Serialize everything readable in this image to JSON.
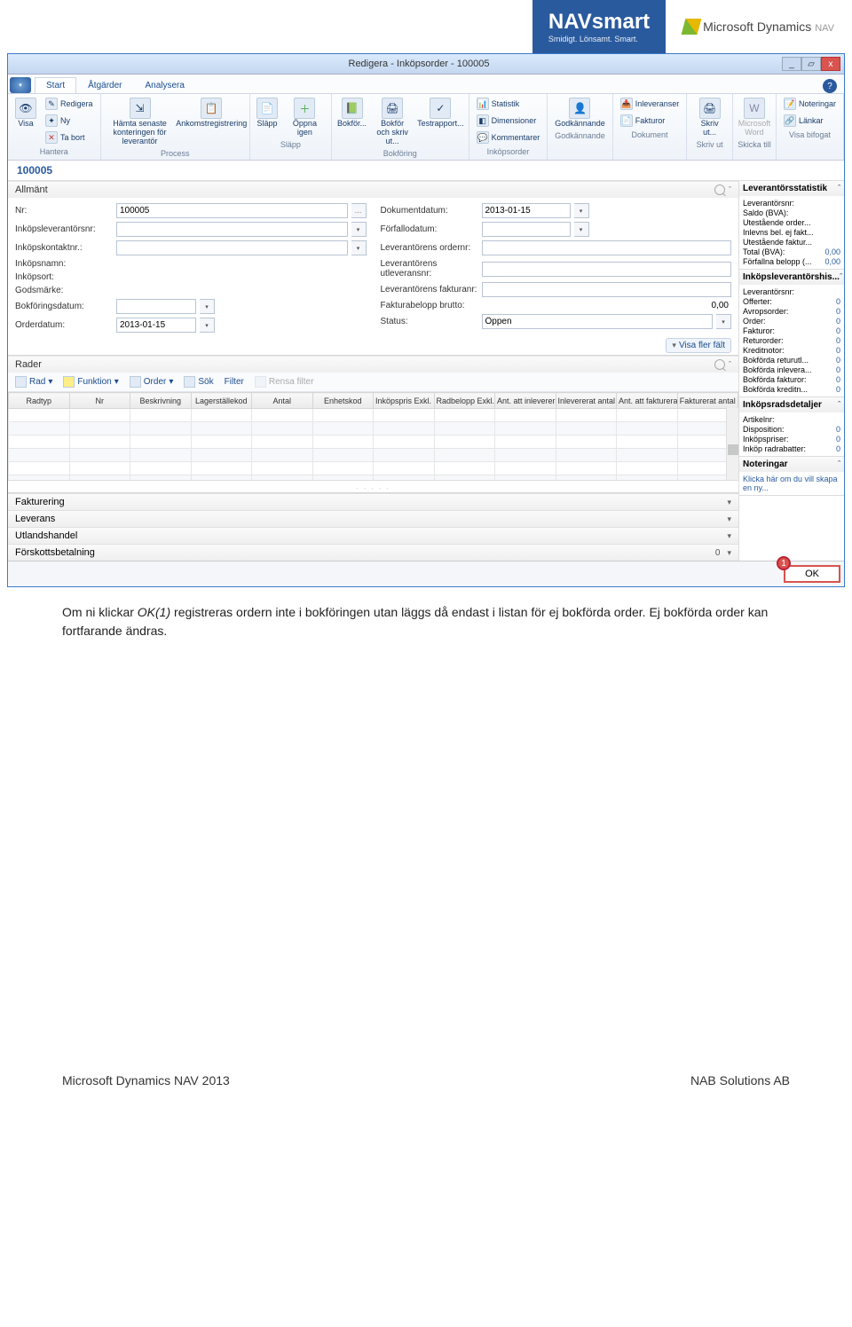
{
  "header": {
    "logo_name": "NAVsmart",
    "logo_tagline": "Smidigt. Lönsamt. Smart.",
    "msdyn": "Microsoft Dynamics",
    "msdyn_sub": "NAV"
  },
  "titlebar": {
    "title": "Redigera - Inköpsorder - 100005",
    "minimize": "_",
    "restore": "▱",
    "close": "x"
  },
  "tabs": {
    "start": "Start",
    "atgarder": "Åtgärder",
    "analysera": "Analysera"
  },
  "ribbon": {
    "hantera": {
      "label": "Hantera",
      "visa": "Visa",
      "redigera": "Redigera",
      "ny": "Ny",
      "tabort": "Ta bort"
    },
    "process": {
      "label": "Process",
      "hamta": "Hämta senaste konteringen för leverantör",
      "ankomst": "Ankomstregistrering"
    },
    "slapp": {
      "label": "Släpp",
      "slapp": "Släpp",
      "oppnaigen": "Öppna igen"
    },
    "bokforing": {
      "label": "Bokföring",
      "bokfor": "Bokför...",
      "bokforoch": "Bokför och skriv ut...",
      "testrapport": "Testrapport..."
    },
    "inkopsorder": {
      "label": "Inköpsorder",
      "statistik": "Statistik",
      "dimensioner": "Dimensioner",
      "kommentarer": "Kommentarer"
    },
    "godkannande": {
      "label": "Godkännande",
      "godkannande": "Godkännande"
    },
    "dokument": {
      "label": "Dokument",
      "inleveranser": "Inleveranser",
      "fakturor": "Fakturor"
    },
    "skrivut": {
      "label": "Skriv ut",
      "skrivut": "Skriv ut..."
    },
    "skickatill": {
      "label": "Skicka till",
      "word": "Microsoft Word"
    },
    "visabifogat": {
      "label": "Visa bifogat",
      "noteringar": "Noteringar",
      "lankar": "Länkar"
    }
  },
  "record_no": "100005",
  "allmant": {
    "title": "Allmänt",
    "left": {
      "nr": {
        "label": "Nr:",
        "value": "100005"
      },
      "inkopsleverantorsnr": {
        "label": "Inköpsleverantörsnr:",
        "value": ""
      },
      "inkopskontaktnr": {
        "label": "Inköpskontaktnr.:",
        "value": ""
      },
      "inkopsnamn": {
        "label": "Inköpsnamn:",
        "value": ""
      },
      "inkopsort": {
        "label": "Inköpsort:",
        "value": ""
      },
      "godsmarke": {
        "label": "Godsmärke:",
        "value": ""
      },
      "bokforingsdatum": {
        "label": "Bokföringsdatum:",
        "value": ""
      },
      "orderdatum": {
        "label": "Orderdatum:",
        "value": "2013-01-15"
      }
    },
    "right": {
      "dokumentdatum": {
        "label": "Dokumentdatum:",
        "value": "2013-01-15"
      },
      "forfallodatum": {
        "label": "Förfallodatum:",
        "value": ""
      },
      "leverantorensordernr": {
        "label": "Leverantörens ordernr:",
        "value": ""
      },
      "leverantorensutleveransnr": {
        "label": "Leverantörens utleveransnr:",
        "value": ""
      },
      "leverantorensfakturanr": {
        "label": "Leverantörens fakturanr:",
        "value": ""
      },
      "fakturabelopp": {
        "label": "Fakturabelopp brutto:",
        "value": "0,00"
      },
      "status": {
        "label": "Status:",
        "value": "Öppen"
      }
    },
    "show_more": "Visa fler fält"
  },
  "rader": {
    "title": "Rader",
    "toolbar": {
      "rad": "Rad",
      "funktion": "Funktion",
      "order": "Order",
      "sok": "Sök",
      "filter": "Filter",
      "rensa": "Rensa filter"
    },
    "columns": [
      "Radtyp",
      "Nr",
      "Beskrivning",
      "Lagerställekod",
      "Antal",
      "Enhetskod",
      "Inköpspris Exkl. moms",
      "Radbelopp Exkl. moms",
      "Ant. att inlevereras",
      "Inlevererat antal",
      "Ant. att fakturera",
      "Fakturerat antal"
    ]
  },
  "collapsed": {
    "fakturering": "Fakturering",
    "leverans": "Leverans",
    "utlandshandel": "Utlandshandel",
    "forskott": {
      "label": "Förskottsbetalning",
      "summary": "0"
    }
  },
  "factboxes": {
    "levstat": {
      "title": "Leverantörsstatistik",
      "rows": [
        {
          "l": "Leverantörsnr:",
          "v": ""
        },
        {
          "l": "Saldo (BVA):",
          "v": ""
        },
        {
          "l": "Utestående order...",
          "v": ""
        },
        {
          "l": "Inlevns bel. ej fakt...",
          "v": ""
        },
        {
          "l": "Utestående faktur...",
          "v": ""
        },
        {
          "l": "Total (BVA):",
          "v": "0,00"
        },
        {
          "l": "Förfallna belopp (...",
          "v": "0,00"
        }
      ]
    },
    "levhist": {
      "title": "Inköpsleverantörshis...",
      "rows": [
        {
          "l": "Leverantörsnr:",
          "v": ""
        },
        {
          "l": "Offerter:",
          "v": "0"
        },
        {
          "l": "Avropsorder:",
          "v": "0"
        },
        {
          "l": "Order:",
          "v": "0"
        },
        {
          "l": "Fakturor:",
          "v": "0"
        },
        {
          "l": "Returorder:",
          "v": "0"
        },
        {
          "l": "Kreditnotor:",
          "v": "0"
        },
        {
          "l": "Bokförda returutl...",
          "v": "0"
        },
        {
          "l": "Bokförda inlevera...",
          "v": "0"
        },
        {
          "l": "Bokförda fakturor:",
          "v": "0"
        },
        {
          "l": "Bokförda kreditn...",
          "v": "0"
        }
      ]
    },
    "raddetaljer": {
      "title": "Inköpsradsdetaljer",
      "rows": [
        {
          "l": "Artikelnr:",
          "v": ""
        },
        {
          "l": "Disposition:",
          "v": "0"
        },
        {
          "l": "Inköpspriser:",
          "v": "0"
        },
        {
          "l": "Inköp radrabatter:",
          "v": "0"
        }
      ]
    },
    "noteringar": {
      "title": "Noteringar",
      "hint": "Klicka här om du vill skapa en ny..."
    }
  },
  "ok": {
    "label": "OK",
    "marker": "1"
  },
  "doc_paragraph": {
    "pre": "Om ni klickar ",
    "ok": "OK(1) ",
    "post": "registreras ordern inte i bokföringen utan läggs då endast i listan för ej bokförda order. Ej bokförda order kan fortfarande ändras."
  },
  "footer": {
    "left": "Microsoft Dynamics NAV 2013",
    "right": "NAB Solutions AB"
  }
}
